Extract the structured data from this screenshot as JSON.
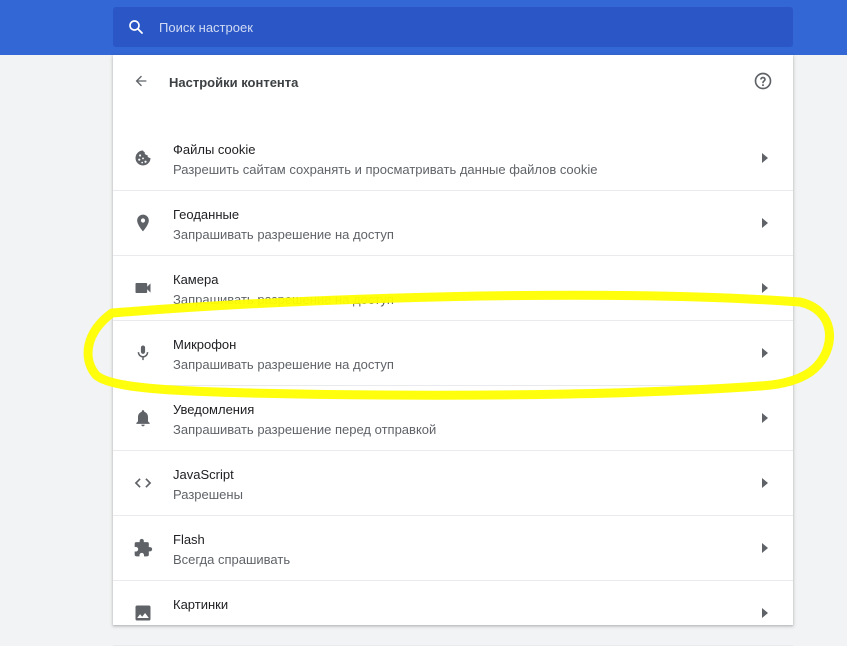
{
  "search": {
    "placeholder": "Поиск настроек",
    "icon": "search-icon"
  },
  "header": {
    "title": "Настройки контента",
    "back_icon": "arrow-back-icon",
    "help_icon": "help-icon"
  },
  "items": [
    {
      "title": "Файлы cookie",
      "subtitle": "Разрешить сайтам сохранять и просматривать данные файлов cookie",
      "icon": "cookie-icon"
    },
    {
      "title": "Геоданные",
      "subtitle": "Запрашивать разрешение на доступ",
      "icon": "location-icon"
    },
    {
      "title": "Камера",
      "subtitle": "Запрашивать разрешение на доступ",
      "icon": "camera-icon"
    },
    {
      "title": "Микрофон",
      "subtitle": "Запрашивать разрешение на доступ",
      "icon": "microphone-icon"
    },
    {
      "title": "Уведомления",
      "subtitle": "Запрашивать разрешение перед отправкой",
      "icon": "bell-icon"
    },
    {
      "title": "JavaScript",
      "subtitle": "Разрешены",
      "icon": "code-icon"
    },
    {
      "title": "Flash",
      "subtitle": "Всегда спрашивать",
      "icon": "puzzle-icon"
    },
    {
      "title": "Картинки",
      "subtitle": "",
      "icon": "image-icon"
    }
  ],
  "colors": {
    "topbar": "#3367d6",
    "search_bg": "#2a56c6",
    "highlight": "#ffff00"
  }
}
